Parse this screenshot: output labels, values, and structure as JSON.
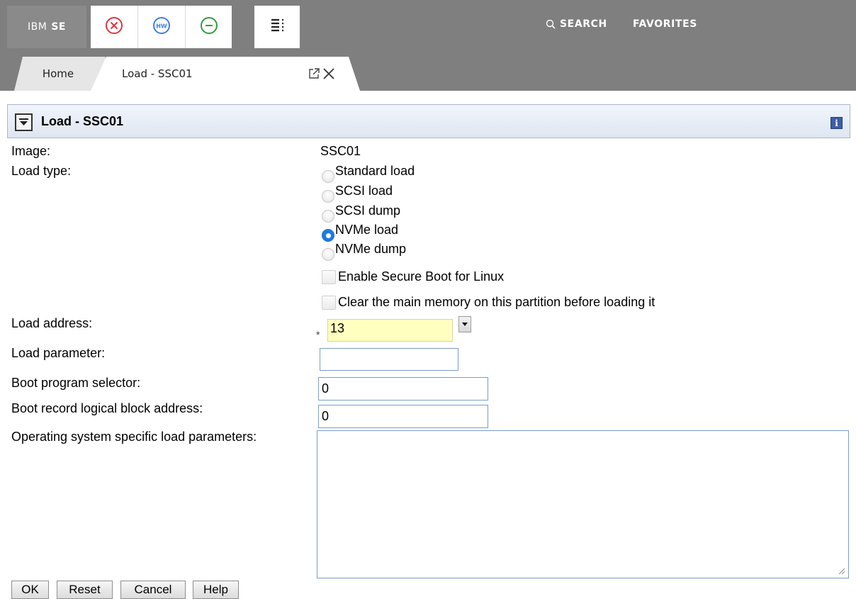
{
  "topbar": {
    "brand_prefix": "IBM",
    "brand_name": "SE",
    "tools": [
      {
        "icon": "error-circle-icon",
        "color": "#e0343e"
      },
      {
        "icon": "hw-circle-icon",
        "color": "#3d7ee3",
        "text": "HW"
      },
      {
        "icon": "minus-circle-icon",
        "color": "#2f9c3a"
      },
      {
        "icon": "task-list-icon",
        "color": "#222222"
      }
    ],
    "search_label": "SEARCH",
    "favorites_label": "FAVORITES"
  },
  "tabs": [
    {
      "label": "Home",
      "active": false
    },
    {
      "label": "Load - SSC01",
      "active": true
    }
  ],
  "panel": {
    "title": "Load - SSC01",
    "info_icon_text": "i"
  },
  "form": {
    "image_label": "Image:",
    "image_value": "SSC01",
    "load_type_label": "Load type:",
    "load_types": [
      {
        "label": "Standard load",
        "selected": false
      },
      {
        "label": "SCSI load",
        "selected": false
      },
      {
        "label": "SCSI dump",
        "selected": false
      },
      {
        "label": "NVMe load",
        "selected": true
      },
      {
        "label": "NVMe dump",
        "selected": false
      }
    ],
    "secure_boot_label": "Enable Secure Boot for Linux",
    "secure_boot_checked": false,
    "clear_memory_label": "Clear the main memory on this partition before loading it",
    "clear_memory_checked": false,
    "load_address_label": "Load address:",
    "required_marker": "*",
    "load_address_value": "13",
    "load_parameter_label": "Load parameter:",
    "load_parameter_value": "",
    "boot_program_selector_label": "Boot program selector:",
    "boot_program_selector_value": "0",
    "boot_record_lba_label": "Boot record logical block address:",
    "boot_record_lba_value": "0",
    "os_load_params_label": "Operating system specific load parameters:",
    "os_load_params_value": ""
  },
  "buttons": {
    "ok": "OK",
    "reset": "Reset",
    "cancel": "Cancel",
    "help": "Help"
  },
  "colors": {
    "topbar_bg": "#7f7f7f",
    "panel_header_border": "#a9b6cf",
    "required_field_bg": "#ffffc0",
    "radio_selected": "#1f7ae0"
  }
}
